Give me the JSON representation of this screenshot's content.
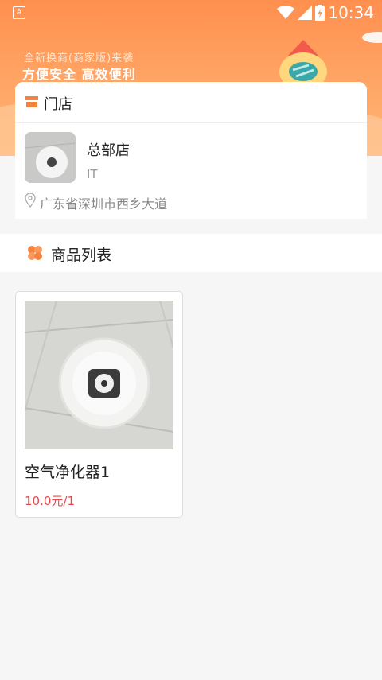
{
  "status_bar": {
    "time": "10:34",
    "app_badge": "A"
  },
  "hero": {
    "tagline": "全新换商(商家版)来袭",
    "slogan": "方便安全  高效便利",
    "accent_color": "#ff8f4f"
  },
  "store_section": {
    "title": "门店",
    "store": {
      "name": "总部店",
      "category": "IT",
      "address": "广东省深圳市西乡大道"
    }
  },
  "goods_section": {
    "title": "商品列表",
    "products": [
      {
        "name": "空气净化器1",
        "price": "10.0元/1"
      }
    ]
  }
}
